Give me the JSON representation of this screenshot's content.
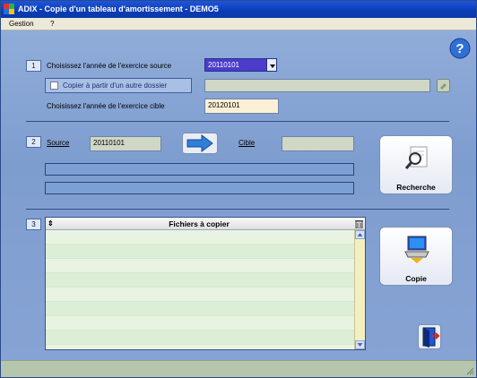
{
  "window": {
    "title": "ADIX - Copie d'un tableau d'amortissement - DEMO5"
  },
  "menu": {
    "items": [
      "Gestion",
      "?"
    ]
  },
  "step1": {
    "number": "1",
    "source_year_label": "Choisissez l'année de l'exercice source",
    "source_year_value": "20110101",
    "copy_other_folder_label": "Copier à partir d'un autre dossier",
    "folder_path_value": "",
    "target_year_label": "Choisissez l'année de l'exercice cible",
    "target_year_value": "20120101"
  },
  "step2": {
    "number": "2",
    "source_label": "Source",
    "source_value": "20110101",
    "target_label": "Cible",
    "target_value": "",
    "search_button_label": "Recherche"
  },
  "step3": {
    "number": "3",
    "files_header": "Fichiers à copier",
    "files": [],
    "copy_button_label": "Copie"
  },
  "colors": {
    "title_bar": "#0a3cb8",
    "combo_selected": "#4c3cc9",
    "disabled_field": "#cfd7c5",
    "client_background": "#86a3d4"
  },
  "icons": {
    "app": "app-icon",
    "help": "help-icon",
    "browse": "folder-browse-icon",
    "arrow": "arrow-right-icon",
    "search": "magnifier-icon",
    "copy": "computer-copy-icon",
    "exit": "exit-door-icon",
    "grid_delete": "trash-icon"
  }
}
